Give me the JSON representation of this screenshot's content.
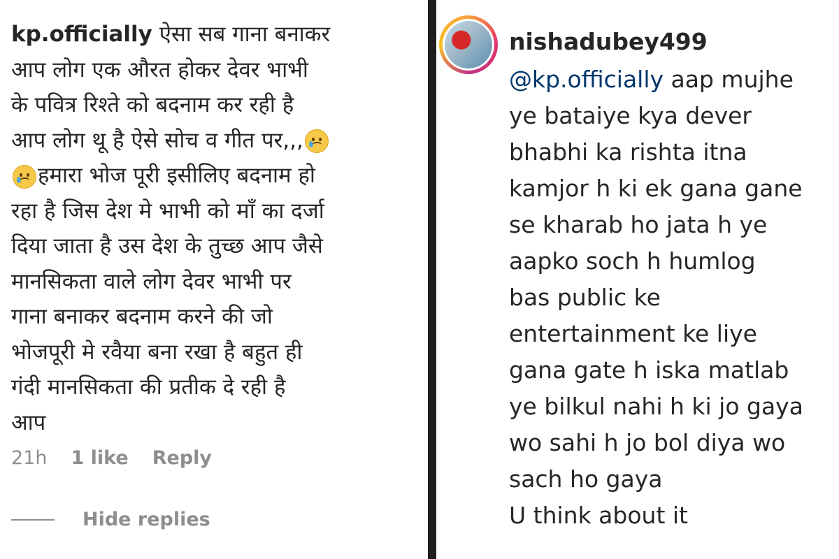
{
  "left_comment": {
    "username": "kp.officially",
    "text_part1": " ऐसा सब गाना बनाकर\nआप लोग एक औरत होकर देवर भाभी\nके पवित्र रिश्ते को बदनाम कर रही है\nआप लोग थू है ऐसे सोच व गीत पर,,,",
    "text_part2": "हमारा भोज पूरी इसीलिए बदनाम हो\nरहा है जिस देश मे भाभी को माँ का दर्जा\nदिया जाता है उस देश के तुच्छ आप जैसे\nमानसिकता वाले लोग देवर भाभी पर\nगाना बनाकर बदनाम करने की जो\nभोजपूरी मे रवैया बना रखा है बहुत ही\nगंदी मानसिकता की प्रतीक दे रही है\nआप",
    "emoji": "crying-face-icon",
    "time": "21h",
    "likes": "1 like",
    "reply_label": "Reply",
    "hide_replies_label": "Hide replies"
  },
  "right_comment": {
    "username": "nishadubey499",
    "mention": "@kp.officially",
    "text": " aap mujhe\nye bataiye kya dever\nbhabhi ka rishta itna\nkamjor h ki ek gana gane\nse kharab ho jata h ye\naapko soch h humlog\nbas public ke\nentertainment ke liye\ngana gate h iska matlab\nye bilkul nahi h ki jo gaya\nwo sahi h jo bol diya wo\nsach ho gaya\nU think about it"
  },
  "colors": {
    "text": "#262626",
    "secondary": "#8e8e8e",
    "mention": "#00376b",
    "divider": "#1e1e1e"
  }
}
